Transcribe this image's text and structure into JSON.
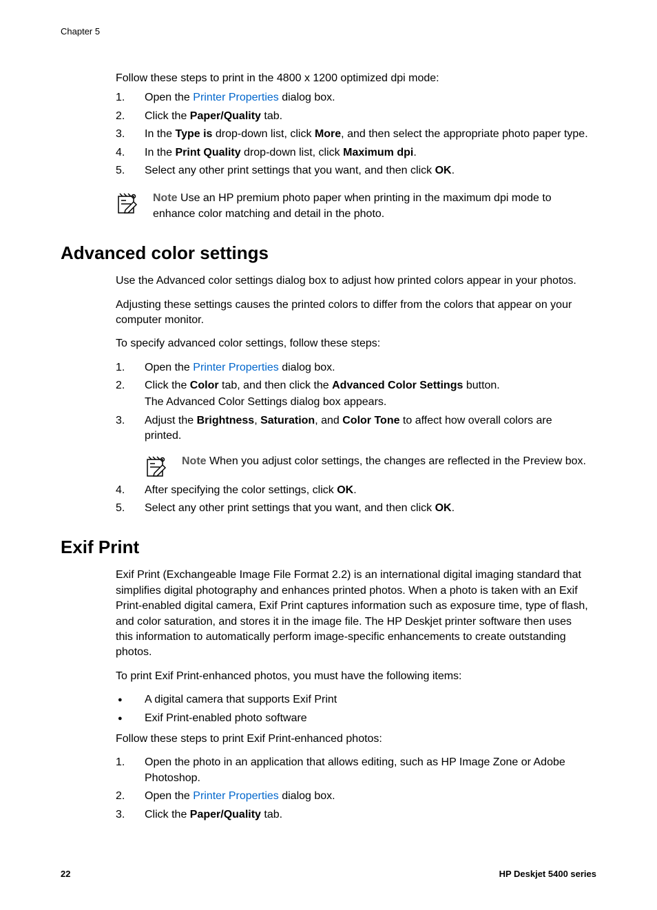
{
  "chapterHeader": "Chapter 5",
  "section1": {
    "intro": "Follow these steps to print in the 4800 x 1200 optimized dpi mode:",
    "step1_pre": "Open the ",
    "step1_link": "Printer Properties",
    "step1_post": " dialog box.",
    "step2_pre": "Click the ",
    "step2_bold": "Paper/Quality",
    "step2_post": " tab.",
    "step3_pre": "In the ",
    "step3_bold1": "Type is",
    "step3_mid": " drop-down list, click ",
    "step3_bold2": "More",
    "step3_post": ", and then select the appropriate photo paper type.",
    "step4_pre": "In the ",
    "step4_bold1": "Print Quality",
    "step4_mid": " drop-down list, click ",
    "step4_bold2": "Maximum dpi",
    "step4_post": ".",
    "step5_pre": "Select any other print settings that you want, and then click ",
    "step5_bold": "OK",
    "step5_post": ".",
    "note_label": "Note",
    "note_text": " Use an HP premium photo paper when printing in the maximum dpi mode to enhance color matching and detail in the photo."
  },
  "section2": {
    "heading": "Advanced color settings",
    "para1": "Use the Advanced color settings dialog box to adjust how printed colors appear in your photos.",
    "para2": "Adjusting these settings causes the printed colors to differ from the colors that appear on your computer monitor.",
    "para3": "To specify advanced color settings, follow these steps:",
    "step1_pre": "Open the ",
    "step1_link": "Printer Properties",
    "step1_post": " dialog box.",
    "step2_pre": "Click the ",
    "step2_bold1": "Color",
    "step2_mid": " tab, and then click the ",
    "step2_bold2": "Advanced Color Settings",
    "step2_post": " button.",
    "step2_sub": "The Advanced Color Settings dialog box appears.",
    "step3_pre": "Adjust the ",
    "step3_bold1": "Brightness",
    "step3_sep1": ", ",
    "step3_bold2": "Saturation",
    "step3_sep2": ", and ",
    "step3_bold3": "Color Tone",
    "step3_post": " to affect how overall colors are printed.",
    "note_label": "Note",
    "note_text": " When you adjust color settings, the changes are reflected in the Preview box.",
    "step4_pre": "After specifying the color settings, click ",
    "step4_bold": "OK",
    "step4_post": ".",
    "step5_pre": "Select any other print settings that you want, and then click ",
    "step5_bold": "OK",
    "step5_post": "."
  },
  "section3": {
    "heading": "Exif Print",
    "para1": "Exif Print (Exchangeable Image File Format 2.2) is an international digital imaging standard that simplifies digital photography and enhances printed photos. When a photo is taken with an Exif Print-enabled digital camera, Exif Print captures information such as exposure time, type of flash, and color saturation, and stores it in the image file. The HP Deskjet printer software then uses this information to automatically perform image-specific enhancements to create outstanding photos.",
    "para2": "To print Exif Print-enhanced photos, you must have the following items:",
    "bullet1": "A digital camera that supports Exif Print",
    "bullet2": "Exif Print-enabled photo software",
    "para3": "Follow these steps to print Exif Print-enhanced photos:",
    "step1": "Open the photo in an application that allows editing, such as HP Image Zone or Adobe Photoshop.",
    "step2_pre": "Open the ",
    "step2_link": "Printer Properties",
    "step2_post": " dialog box.",
    "step3_pre": "Click the ",
    "step3_bold": "Paper/Quality",
    "step3_post": " tab."
  },
  "footer": {
    "pageNum": "22",
    "series": "HP Deskjet 5400 series"
  }
}
